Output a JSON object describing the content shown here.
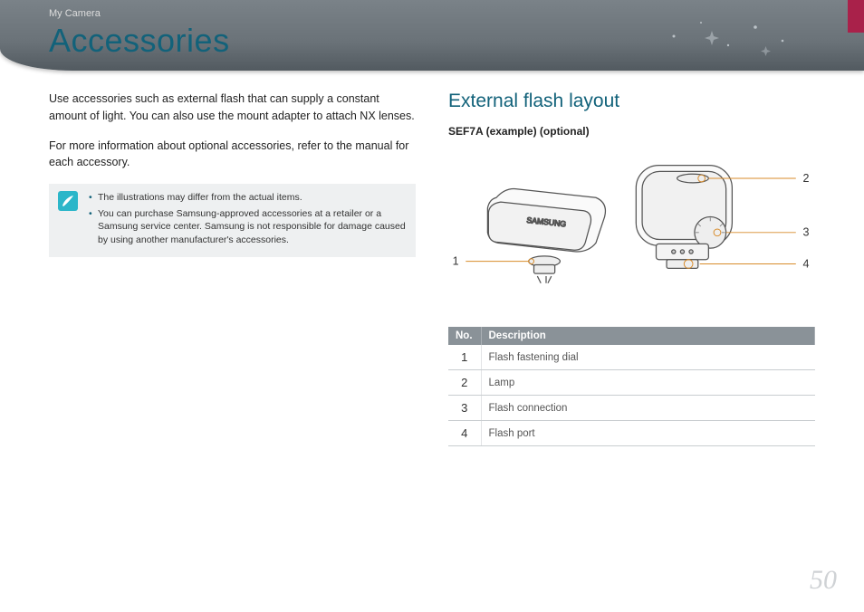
{
  "breadcrumb": "My Camera",
  "title": "Accessories",
  "left": {
    "para1": "Use accessories such as external flash that can supply a constant amount of light. You can also use the mount adapter to attach NX lenses.",
    "para2": "For more information about optional accessories, refer to the manual for each accessory.",
    "notes": [
      "The illustrations may differ from the actual items.",
      "You can purchase Samsung-approved accessories at a retailer or a Samsung service center. Samsung is not responsible for damage caused by using another manufacturer's accessories."
    ]
  },
  "right": {
    "section_title": "External flash layout",
    "subhead": "SEF7A (example) (optional)",
    "device_label": "SAMSUNG",
    "callouts": {
      "c1": "1",
      "c2": "2",
      "c3": "3",
      "c4": "4"
    },
    "table": {
      "headers": {
        "no": "No.",
        "desc": "Description"
      },
      "rows": [
        {
          "no": "1",
          "desc": "Flash fastening dial"
        },
        {
          "no": "2",
          "desc": "Lamp"
        },
        {
          "no": "3",
          "desc": "Flash connection"
        },
        {
          "no": "4",
          "desc": "Flash port"
        }
      ]
    }
  },
  "page_number": "50"
}
